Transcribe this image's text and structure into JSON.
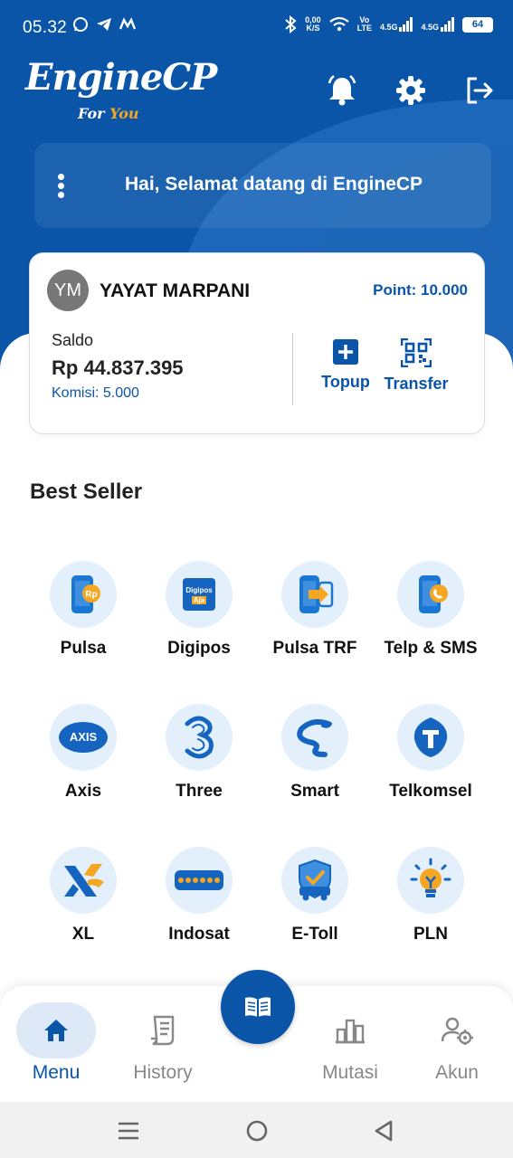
{
  "status_bar": {
    "time": "05.32",
    "speed_value": "0,00",
    "speed_unit": "K/S",
    "volte_top": "Vo",
    "volte_bottom": "LTE",
    "network_1": "4.5G",
    "network_2": "4.5G",
    "battery": "64"
  },
  "header": {
    "logo_main": "EngineCP",
    "logo_for": "For",
    "logo_you": "You",
    "welcome": "Hai, Selamat datang di EngineCP"
  },
  "account": {
    "initials": "YM",
    "name": "YAYAT MARPANI",
    "point": "Point: 10.000",
    "saldo_label": "Saldo",
    "saldo_value": "Rp 44.837.395",
    "komisi": "Komisi: 5.000",
    "topup_label": "Topup",
    "transfer_label": "Transfer"
  },
  "best_seller": {
    "title": "Best Seller",
    "items": [
      {
        "label": "Pulsa",
        "icon": "pulsa-icon"
      },
      {
        "label": "Digipos",
        "icon": "digipos-icon",
        "icon_text_1": "Digipos",
        "icon_text_2": "Aja"
      },
      {
        "label": "Pulsa TRF",
        "icon": "pulsa-transfer-icon"
      },
      {
        "label": "Telp & SMS",
        "icon": "telp-sms-icon"
      },
      {
        "label": "Axis",
        "icon": "axis-icon",
        "icon_text": "AXIS"
      },
      {
        "label": "Three",
        "icon": "three-icon"
      },
      {
        "label": "Smart",
        "icon": "smart-icon"
      },
      {
        "label": "Telkomsel",
        "icon": "telkomsel-icon"
      },
      {
        "label": "XL",
        "icon": "xl-icon"
      },
      {
        "label": "Indosat",
        "icon": "indosat-icon"
      },
      {
        "label": "E-Toll",
        "icon": "etoll-icon"
      },
      {
        "label": "PLN",
        "icon": "pln-icon"
      }
    ]
  },
  "bottom_nav": {
    "menu": "Menu",
    "history": "History",
    "mutasi": "Mutasi",
    "akun": "Akun"
  },
  "colors": {
    "primary": "#0a55a8",
    "accent": "#f5a623",
    "icon_bg": "#e3f0fb"
  }
}
